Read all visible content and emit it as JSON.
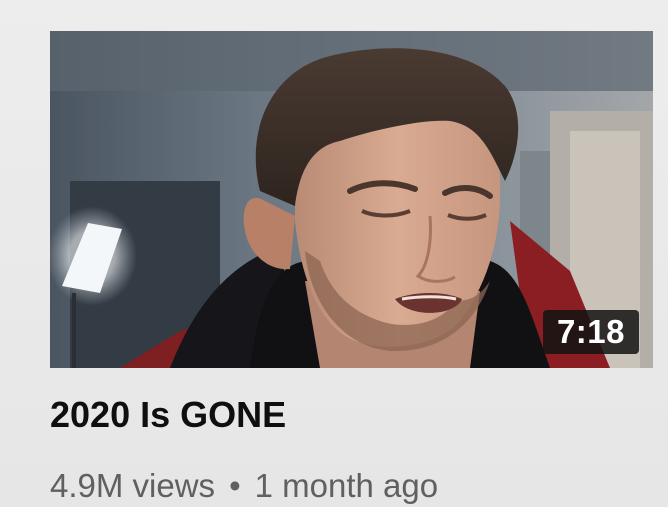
{
  "video": {
    "title": "2020 Is GONE",
    "duration": "7:18",
    "views": "4.9M views",
    "separator": "•",
    "age": "1 month ago"
  },
  "colors": {
    "title_text": "#0f0f0f",
    "meta_text": "#606060",
    "duration_badge_bg": "#141414",
    "duration_text": "#ffffff",
    "card_bg": "#e9e9e9"
  }
}
